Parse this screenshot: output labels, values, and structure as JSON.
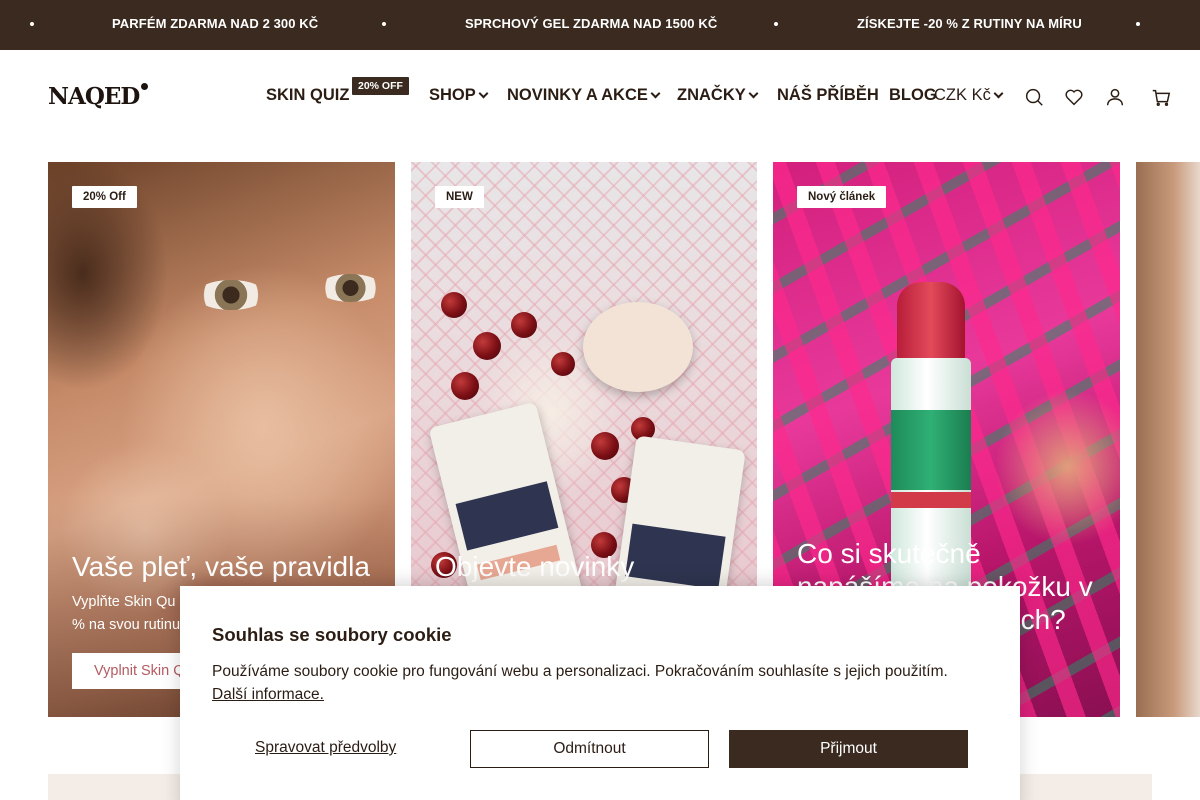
{
  "announcement": {
    "messages": [
      "PARFÉM ZDARMA NAD 2 300 KČ",
      "SPRCHOVÝ GEL ZDARMA NAD 1500 KČ",
      "ZÍSKEJTE -20 % Z RUTINY NA MÍRU"
    ]
  },
  "header": {
    "logo": "NAQED",
    "nav": {
      "skin_quiz": "SKIN QUIZ",
      "skin_quiz_badge": "20% OFF",
      "shop": "SHOP",
      "novinky": "NOVINKY A AKCE",
      "znacky": "ZNAČKY",
      "pribeh": "NÁŠ PŘÍBĚH",
      "blog": "BLOG",
      "currency": "CZK Kč"
    },
    "icons": [
      "search-icon",
      "heart-icon",
      "account-icon",
      "cart-icon"
    ]
  },
  "cards": [
    {
      "badge": "20% Off",
      "title": "Vaše pleť, vaše pravidla",
      "desc_line1": "Vyplňte Skin Qu",
      "desc_line2": "% na svou rutinu",
      "cta": "Vyplnit Skin Q"
    },
    {
      "badge": "NEW",
      "title": "Objevte novinky"
    },
    {
      "badge": "Nový článek",
      "title_line1": "Co si skutečně",
      "title_line2": "napášíme na pokožku v",
      "title_line3": "ech?"
    }
  ],
  "cookie": {
    "title": "Souhlas se soubory cookie",
    "text": "Používáme soubory cookie pro fungování webu a personalizaci. Pokračováním souhlasíte s jejich použitím.",
    "link": "Další informace.",
    "manage": "Spravovat předvolby",
    "decline": "Odmítnout",
    "accept": "Přijmout"
  },
  "colors": {
    "brand_dark": "#3a2a1f",
    "cta_text": "#b35b63",
    "strip": "#f4ece6"
  }
}
